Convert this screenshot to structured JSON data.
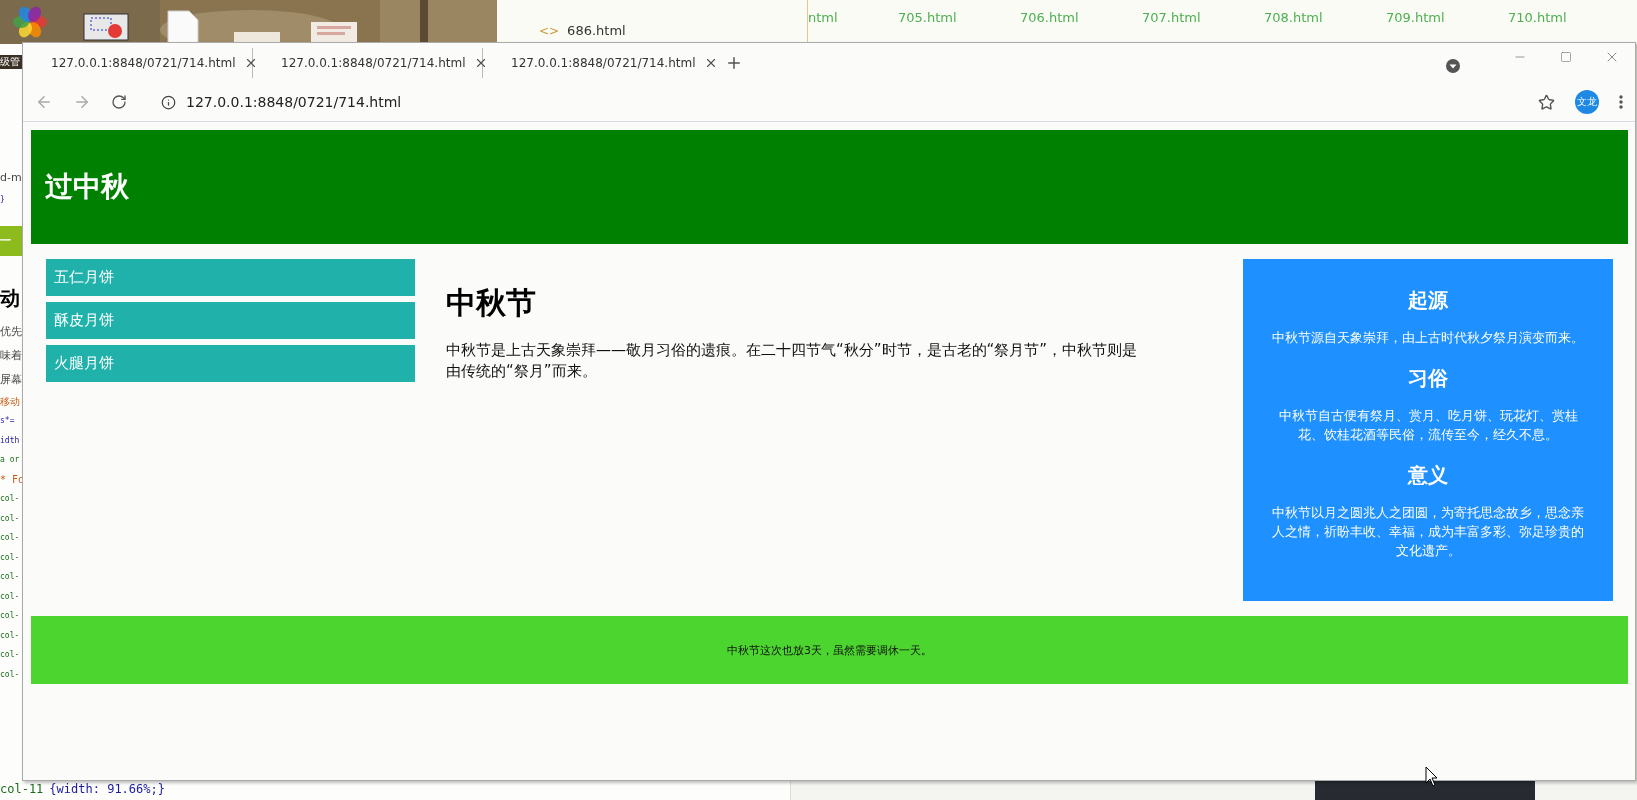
{
  "desktop": {
    "icon_label": "级管",
    "file_window": {
      "code_mark": "<>",
      "recent_file": "686.html",
      "files": [
        "ntml",
        "705.html",
        "706.html",
        "707.html",
        "708.html",
        "709.html",
        "710.html"
      ]
    },
    "editor_lines": [
      {
        "kind": "text",
        "text": "d-m"
      },
      {
        "kind": "code",
        "text": "}"
      },
      {
        "kind": "button",
        "text": "一"
      },
      {
        "kind": "heading",
        "text": "动"
      },
      {
        "kind": "text",
        "text": "优先"
      },
      {
        "kind": "text",
        "text": "味着"
      },
      {
        "kind": "text",
        "text": "屏幕"
      },
      {
        "kind": "comment",
        "text": "移动"
      },
      {
        "kind": "code",
        "text": "s*="
      },
      {
        "kind": "code",
        "text": "idth"
      },
      {
        "kind": "green",
        "text": "a or"
      },
      {
        "kind": "comment",
        "text": "* Fo"
      },
      {
        "kind": "green",
        "text": "col-"
      },
      {
        "kind": "green",
        "text": "col-"
      },
      {
        "kind": "green",
        "text": "col-"
      },
      {
        "kind": "green",
        "text": "col-"
      },
      {
        "kind": "green",
        "text": "col-"
      },
      {
        "kind": "green",
        "text": "col-"
      },
      {
        "kind": "green",
        "text": "col-"
      },
      {
        "kind": "green",
        "text": "col-"
      },
      {
        "kind": "green",
        "text": "col-"
      },
      {
        "kind": "green",
        "text": "col-"
      }
    ],
    "editor_last_line": {
      "selector": "col-11",
      "rule": "{width: 91.66%;}"
    }
  },
  "browser": {
    "tabs": [
      {
        "title": "127.0.0.1:8848/0721/714.html"
      },
      {
        "title": "127.0.0.1:8848/0721/714.html"
      },
      {
        "title": "127.0.0.1:8848/0721/714.html"
      }
    ],
    "address": "127.0.0.1:8848/0721/714.html",
    "profile": "文龙"
  },
  "page": {
    "header": "过中秋",
    "menu": [
      "五仁月饼",
      "酥皮月饼",
      "火腿月饼"
    ],
    "article": {
      "title": "中秋节",
      "body": "中秋节是上古天象崇拜——敬月习俗的遗痕。在二十四节气“秋分”时节，是古老的“祭月节”，中秋节则是由传统的“祭月”而来。"
    },
    "aside": [
      {
        "heading": "起源",
        "text": "中秋节源自天象崇拜，由上古时代秋夕祭月演变而来。"
      },
      {
        "heading": "习俗",
        "text": "中秋节自古便有祭月、赏月、吃月饼、玩花灯、赏桂花、饮桂花酒等民俗，流传至今，经久不息。"
      },
      {
        "heading": "意义",
        "text": "中秋节以月之圆兆人之团圆，为寄托思念故乡，思念亲人之情，祈盼丰收、幸福，成为丰富多彩、弥足珍贵的文化遗产。"
      }
    ],
    "footer": "中秋节这次也放3天，虽然需要调休一天。"
  }
}
